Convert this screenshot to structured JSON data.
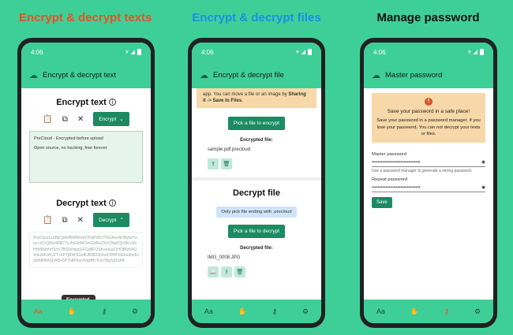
{
  "captions": [
    {
      "text": "Encrypt & decrypt texts",
      "color": "#e8521f"
    },
    {
      "text": "Encrypt & decrypt files",
      "color": "#1a8fe8"
    },
    {
      "text": "Manage password",
      "color": "#111111"
    }
  ],
  "status_time": "4:06",
  "screen1": {
    "title": "Encrypt & decrypt text",
    "encrypt_heading": "Encrypt text",
    "encrypt_button": "Encrypt",
    "input_line1": "PreCloud - Encrypted before upload",
    "input_line2": "Open source, no tracking, free forever",
    "decrypt_heading": "Decrypt text",
    "decrypt_button": "Decrypt",
    "cipher_text": "PreCloud:xuBEQMi4BMNRqH7PqBWO/YEEAxvADNyfaYwoy+xLVQ65v96B77cJhiGhfWOmGiWlzZXnCNqFQUWLi3/bHHi88sbhH3/rS7BS9xWgrGFCpBFOShvwIuuiOHOBfzN4QXekxMUAUZT+5PTjBNHGsdfUB9fl23GheFf9HPIzEbubfedUdj9MKBA5DAB+5PTb8F6nnWqkfffzTcwY8qZgDhAB",
    "toast": "Encrypted."
  },
  "screen2": {
    "title": "Encrypt & decrypt file",
    "banner_prefix": "app. You can move a file or an image by ",
    "banner_bold1": "Sharing it -> Save to Files",
    "banner_suffix": ".",
    "pick_encrypt": "Pick a file to encrypt",
    "encrypted_label": "Encrypted file:",
    "encrypted_name": "sample.pdf.precloud",
    "decrypt_heading": "Decrypt file",
    "decrypt_note": "Only pick file ending with .precloud",
    "pick_decrypt": "Pick a file to decrypt",
    "decrypted_label": "Decrypted file:",
    "decrypted_name": "IMG_0008.JPG"
  },
  "screen3": {
    "title": "Master password",
    "warn_title": "Save your password in a safe place!",
    "warn_body": "Save your password in a password manager. If you lose your password, You can not decrypt your texts or files.",
    "master_label": "Master password",
    "master_value": "••••••••••••••••••••••••••••••••",
    "hint": "Use a password manager to generate a strong password.",
    "repeat_label": "Repeat password",
    "repeat_value": "••••••••••••••••••••••••••••••••",
    "save_button": "Save"
  },
  "nav": {
    "text_icon_label": "Aa"
  }
}
